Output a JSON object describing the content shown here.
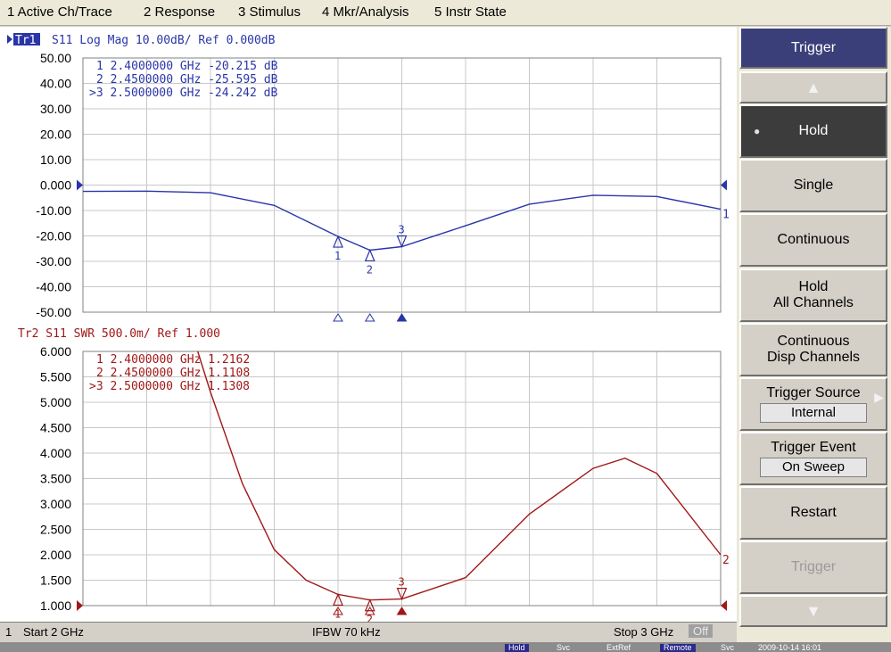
{
  "menu": [
    "1 Active Ch/Trace",
    "2 Response",
    "3 Stimulus",
    "4 Mkr/Analysis",
    "5 Instr State"
  ],
  "trace1": {
    "tag": "Tr1",
    "header": "S11  Log Mag 10.00dB/ Ref 0.000dB",
    "color": "#2a35a8",
    "y_ticks": [
      "50.00",
      "40.00",
      "30.00",
      "20.00",
      "10.00",
      "0.000",
      "-10.00",
      "-20.00",
      "-30.00",
      "-40.00",
      "-50.00"
    ],
    "markers": [
      {
        "label": "1",
        "row": "1   2.4000000 GHz -20.215 dB"
      },
      {
        "label": "2",
        "row": "2   2.4500000 GHz -25.595 dB"
      },
      {
        "label": "3",
        "row": ">3   2.5000000 GHz -24.242 dB"
      }
    ],
    "end_label": "1"
  },
  "trace2": {
    "header": "Tr2  S11  SWR 500.0m/ Ref 1.000",
    "color": "#a01818",
    "y_ticks": [
      "6.000",
      "5.500",
      "5.000",
      "4.500",
      "4.000",
      "3.500",
      "3.000",
      "2.500",
      "2.000",
      "1.500",
      "1.000"
    ],
    "markers": [
      {
        "label": "1",
        "row": "1   2.4000000 GHz  1.2162"
      },
      {
        "label": "2",
        "row": "2   2.4500000 GHz  1.1108"
      },
      {
        "label": "3",
        "row": ">3   2.5000000 GHz  1.1308"
      }
    ],
    "end_label": "2"
  },
  "chart_data": [
    {
      "type": "line",
      "series": [
        {
          "x": [
            2.0,
            2.1,
            2.2,
            2.3,
            2.4,
            2.45,
            2.5,
            2.6,
            2.7,
            2.8,
            2.9,
            3.0
          ],
          "values": [
            -2.5,
            -2.4,
            -3.0,
            -8.0,
            -20.2,
            -25.6,
            -24.2,
            -16.0,
            -7.5,
            -4.0,
            -4.5,
            -9.5
          ]
        }
      ],
      "ylim": [
        -50,
        50
      ],
      "xlim": [
        2.0,
        3.0
      ]
    },
    {
      "type": "line",
      "series": [
        {
          "x": [
            2.18,
            2.2,
            2.25,
            2.3,
            2.35,
            2.4,
            2.45,
            2.5,
            2.6,
            2.7,
            2.8,
            2.85,
            2.9,
            3.0
          ],
          "values": [
            6.0,
            5.2,
            3.4,
            2.1,
            1.5,
            1.22,
            1.11,
            1.13,
            1.55,
            2.8,
            3.7,
            3.9,
            3.6,
            2.0
          ]
        }
      ],
      "ylim": [
        1.0,
        6.0
      ],
      "xlim": [
        2.0,
        3.0
      ]
    }
  ],
  "status": {
    "channel": "1",
    "start": "Start 2 GHz",
    "ifbw": "IFBW 70 kHz",
    "stop": "Stop 3 GHz",
    "off": "Off"
  },
  "softkeys": {
    "title": "Trigger",
    "hold": "Hold",
    "single": "Single",
    "continuous": "Continuous",
    "hold_all_1": "Hold",
    "hold_all_2": "All Channels",
    "cont_disp_1": "Continuous",
    "cont_disp_2": "Disp Channels",
    "trigger_source": "Trigger Source",
    "trigger_source_value": "Internal",
    "trigger_event": "Trigger Event",
    "trigger_event_value": "On Sweep",
    "restart": "Restart",
    "trigger": "Trigger"
  },
  "bottom": [
    "Hold",
    "Svc",
    "ExtRef",
    "Remote",
    "Svc",
    "2009-10-14 16:01"
  ]
}
